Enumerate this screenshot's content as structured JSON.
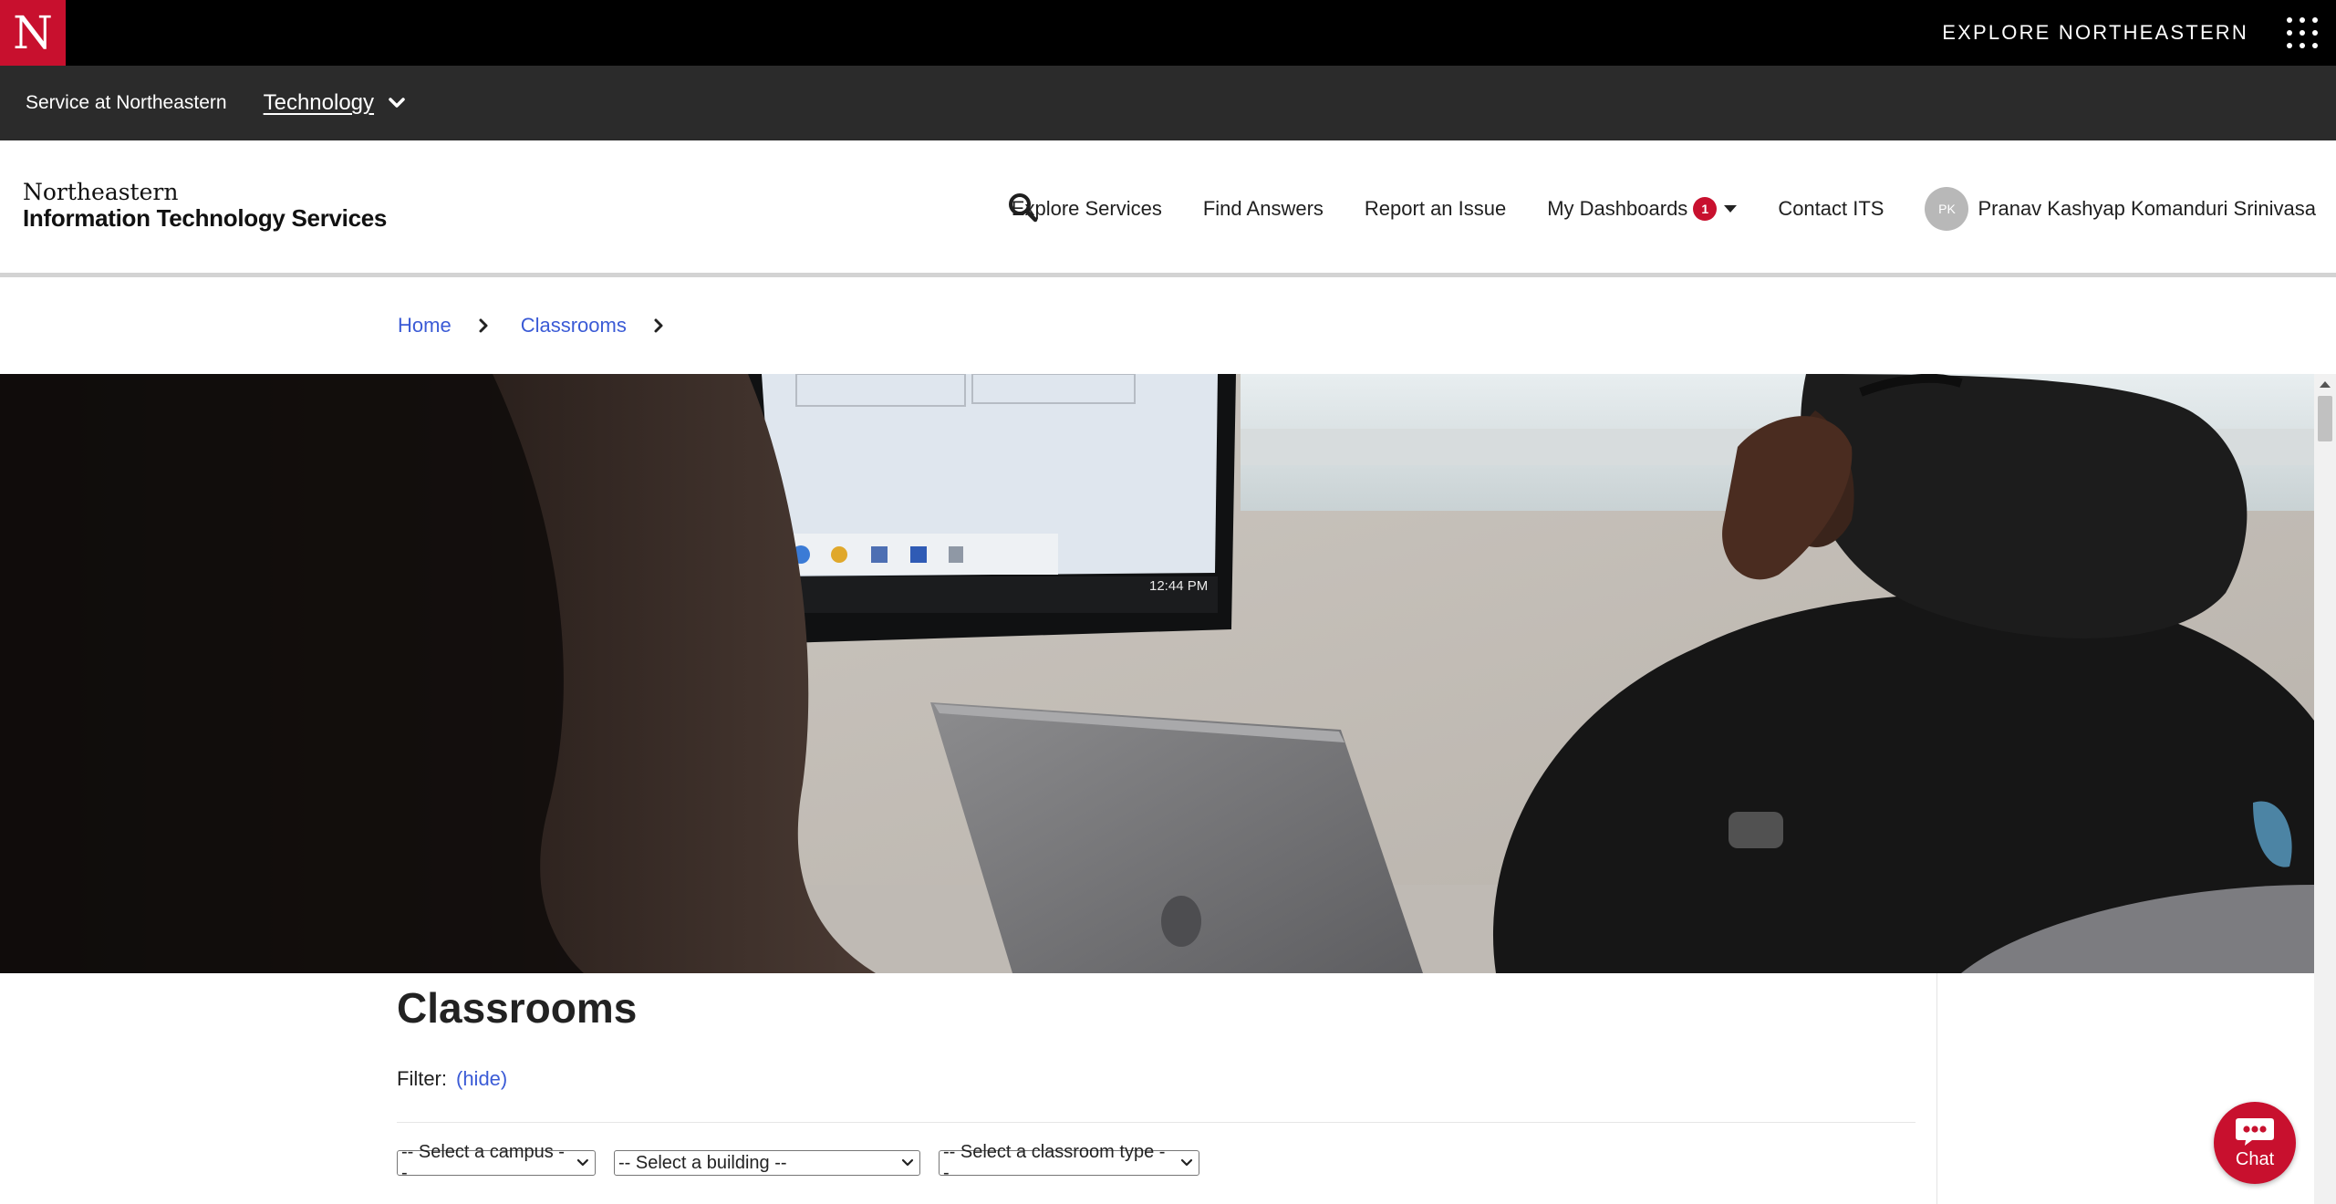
{
  "topbar": {
    "logo_letter": "N",
    "explore_label": "EXPLORE NORTHEASTERN",
    "apps_icon": "grid-dots-icon"
  },
  "servicebar": {
    "service_text": "Service at Northeastern",
    "section_label": "Technology",
    "section_icon": "chevron-down-icon"
  },
  "header": {
    "brand_line1": "Northeastern",
    "brand_line2": "Information Technology Services",
    "search_icon": "search-icon",
    "nav": {
      "explore_services": "Explore Services",
      "find_answers": "Find Answers",
      "report_issue": "Report an Issue",
      "my_dashboards": "My Dashboards",
      "dashboards_badge": "1",
      "contact": "Contact ITS"
    },
    "user": {
      "initials": "PK",
      "name": "Pranav Kashyap Komanduri Srinivasa"
    }
  },
  "breadcrumb": {
    "items": [
      "Home",
      "Classrooms"
    ]
  },
  "hero": {
    "screen_clock": "12:44 PM"
  },
  "main": {
    "title": "Classrooms",
    "filter_label": "Filter:",
    "filter_toggle": "(hide)",
    "selects": {
      "campus": "-- Select a campus --",
      "building": "-- Select a building --",
      "classroom_type": "-- Select a classroom type --"
    }
  },
  "chat": {
    "label": "Chat"
  },
  "colors": {
    "brand_red": "#c8102e",
    "link_blue": "#3b5bd6",
    "service_bar": "#2b2b2b",
    "top_bar": "#000000"
  }
}
